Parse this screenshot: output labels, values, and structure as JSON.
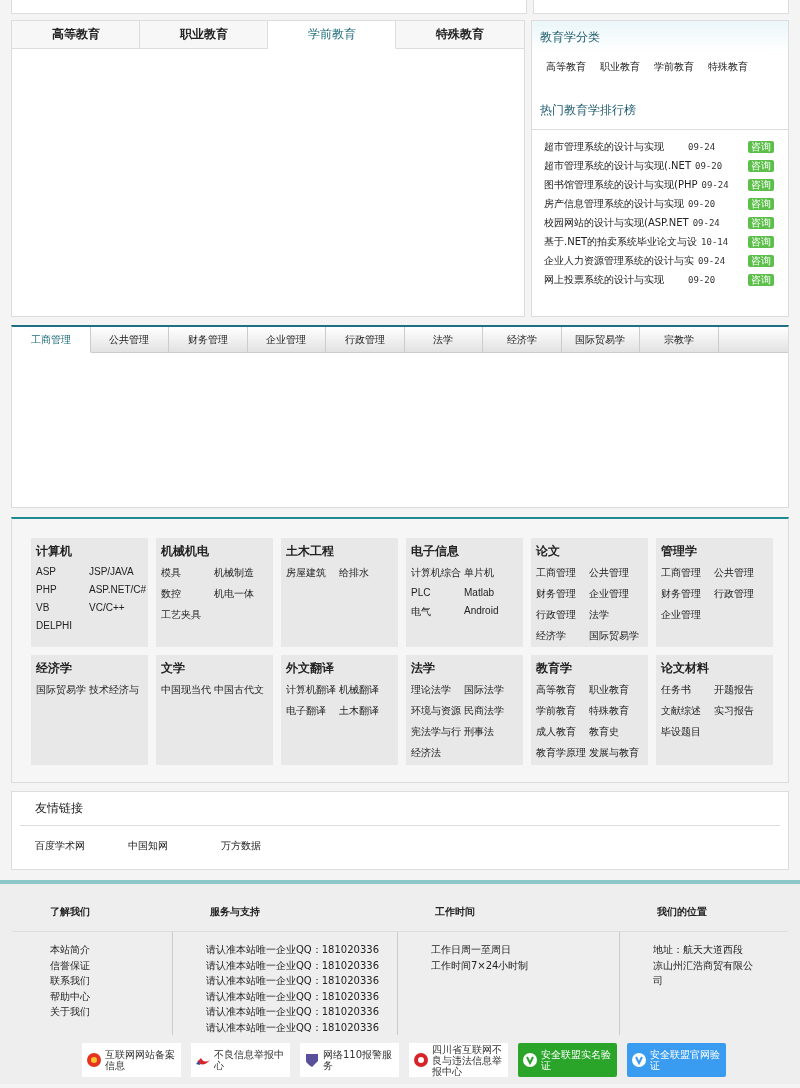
{
  "top_tabs": [
    {
      "label": "高等教育",
      "selected": false
    },
    {
      "label": "职业教育",
      "selected": false
    },
    {
      "label": "学前教育",
      "selected": true
    },
    {
      "label": "特殊教育",
      "selected": false
    }
  ],
  "classification": {
    "title": "教育学分类",
    "items": [
      "高等教育",
      "职业教育",
      "学前教育",
      "特殊教育"
    ]
  },
  "ranking": {
    "title": "热门教育学排行榜",
    "rows": [
      {
        "title": "超市管理系统的设计与实现",
        "date": "09-24",
        "tag": "咨询"
      },
      {
        "title": "超市管理系统的设计与实现(.NET",
        "date": "09-20",
        "tag": "咨询"
      },
      {
        "title": "图书馆管理系统的设计与实现(PHP",
        "date": "09-24",
        "tag": "咨询"
      },
      {
        "title": "房产信息管理系统的设计与实现",
        "date": "09-20",
        "tag": "咨询"
      },
      {
        "title": "校园网站的设计与实现(ASP.NET",
        "date": "09-24",
        "tag": "咨询"
      },
      {
        "title": "基于.NET的拍卖系统毕业论文与设",
        "date": "10-14",
        "tag": "咨询"
      },
      {
        "title": "企业人力资源管理系统的设计与实",
        "date": "09-24",
        "tag": "咨询"
      },
      {
        "title": "网上投票系统的设计与实现",
        "date": "09-20",
        "tag": "咨询"
      }
    ]
  },
  "subject_tabs": [
    {
      "label": "工商管理",
      "selected": true
    },
    {
      "label": "公共管理",
      "selected": false
    },
    {
      "label": "财务管理",
      "selected": false
    },
    {
      "label": "企业管理",
      "selected": false
    },
    {
      "label": "行政管理",
      "selected": false
    },
    {
      "label": "法学",
      "selected": false
    },
    {
      "label": "经济学",
      "selected": false
    },
    {
      "label": "国际贸易学",
      "selected": false
    },
    {
      "label": "宗教学",
      "selected": false
    }
  ],
  "categories": [
    {
      "title": "计算机",
      "items": [
        "ASP",
        "JSP/JAVA",
        "PHP",
        "ASP.NET/C#",
        "VB",
        "VC/C++",
        "DELPHI"
      ]
    },
    {
      "title": "机械机电",
      "items": [
        "模具",
        "机械制造",
        "数控",
        "机电一体",
        "工艺夹具"
      ]
    },
    {
      "title": "土木工程",
      "items": [
        "房屋建筑",
        "给排水"
      ]
    },
    {
      "title": "电子信息",
      "items": [
        "计算机综合",
        "单片机",
        "PLC",
        "Matlab",
        "电气",
        "Android"
      ]
    },
    {
      "title": "论文",
      "items": [
        "工商管理",
        "公共管理",
        "财务管理",
        "企业管理",
        "行政管理",
        "法学",
        "经济学",
        "国际贸易学"
      ]
    },
    {
      "title": "管理学",
      "items": [
        "工商管理",
        "公共管理",
        "财务管理",
        "行政管理",
        "企业管理"
      ]
    },
    {
      "title": "经济学",
      "items": [
        "国际贸易学",
        "技术经济与"
      ]
    },
    {
      "title": "文学",
      "items": [
        "中国现当代",
        "中国古代文"
      ]
    },
    {
      "title": "外文翻译",
      "items": [
        "计算机翻译",
        "机械翻译",
        "电子翻译",
        "土木翻译"
      ]
    },
    {
      "title": "法学",
      "items": [
        "理论法学",
        "国际法学",
        "环境与资源",
        "民商法学",
        "宪法学与行",
        "刑事法",
        "经济法"
      ]
    },
    {
      "title": "教育学",
      "items": [
        "高等教育",
        "职业教育",
        "学前教育",
        "特殊教育",
        "成人教育",
        "教育史",
        "教育学原理",
        "发展与教育"
      ]
    },
    {
      "title": "论文材料",
      "items": [
        "任务书",
        "开题报告",
        "文献综述",
        "实习报告",
        "毕设题目"
      ]
    }
  ],
  "friend_links": {
    "title": "友情链接",
    "links": [
      "百度学术网",
      "中国知网",
      "万方数据"
    ]
  },
  "footer": {
    "columns": [
      {
        "heading": "了解我们",
        "lines": [
          "本站简介",
          "信誉保证",
          "联系我们",
          "帮助中心",
          "关于我们"
        ]
      },
      {
        "heading": "服务与支持",
        "lines": [
          "请认准本站唯一企业QQ：181020336",
          "请认准本站唯一企业QQ：181020336",
          "请认准本站唯一企业QQ：181020336",
          "请认准本站唯一企业QQ：181020336",
          "请认准本站唯一企业QQ：181020336",
          "请认准本站唯一企业QQ：181020336"
        ]
      },
      {
        "heading": "工作时间",
        "lines": [
          "工作日周一至周日",
          "工作时间7×24小时制"
        ]
      },
      {
        "heading": "我们的位置",
        "lines": [
          "地址：航天大道西段",
          "凉山州汇浩商贸有限公司"
        ]
      }
    ]
  },
  "badges": [
    {
      "kind": "emblem",
      "text": "互联网网站备案信息"
    },
    {
      "kind": "swoosh",
      "text": "不良信息举报中心"
    },
    {
      "kind": "shield",
      "text": "网络110报警服务"
    },
    {
      "kind": "spiral",
      "text": "四川省互联网不良与违法信息举报中心"
    },
    {
      "kind": "verify-green",
      "text": "安全联盟实名验证"
    },
    {
      "kind": "verify-blue",
      "text": "安全联盟官网验证"
    }
  ]
}
